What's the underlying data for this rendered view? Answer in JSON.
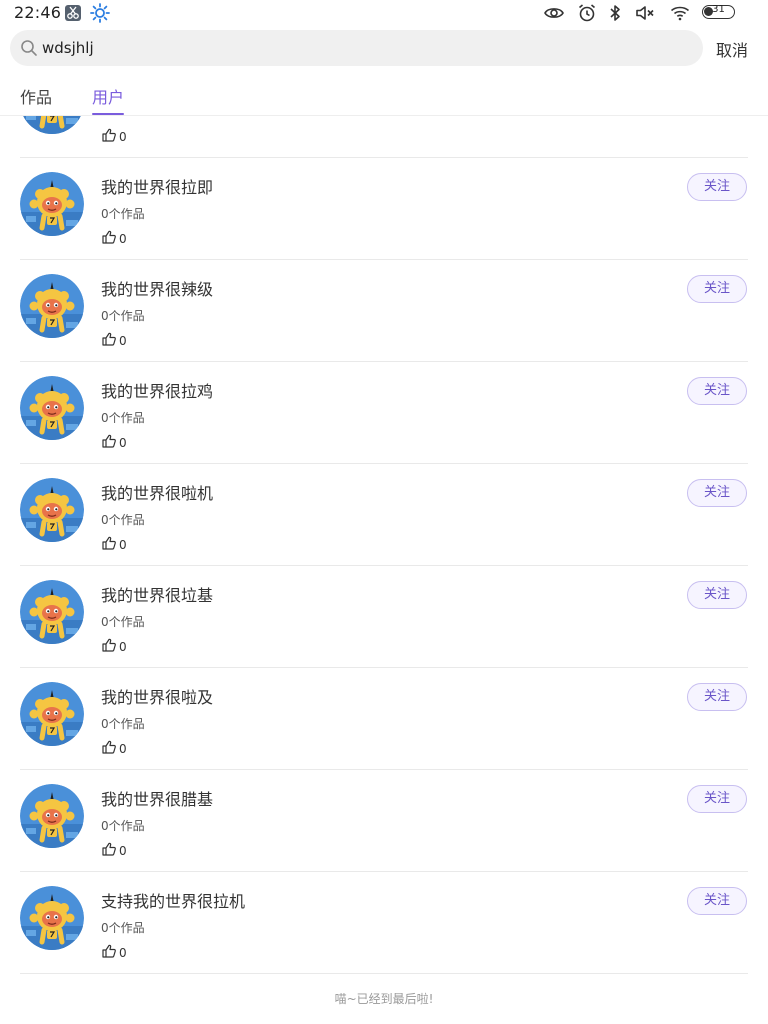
{
  "status_bar": {
    "time": "22:46",
    "battery_level": "31",
    "icons": [
      "scissors-app-icon",
      "brightness-icon",
      "eye-icon",
      "alarm-icon",
      "bluetooth-icon",
      "volume-muted-icon",
      "wifi-icon",
      "battery-icon"
    ]
  },
  "search": {
    "value": "wdsjhlj",
    "cancel_label": "取消"
  },
  "tabs": [
    {
      "label": "作品",
      "active": false
    },
    {
      "label": "用户",
      "active": true
    }
  ],
  "partial_user": {
    "like_count": "0"
  },
  "users": [
    {
      "name": "我的世界很拉即",
      "works": "0个作品",
      "likes": "0",
      "follow_label": "关注"
    },
    {
      "name": "我的世界很辣级",
      "works": "0个作品",
      "likes": "0",
      "follow_label": "关注"
    },
    {
      "name": "我的世界很拉鸡",
      "works": "0个作品",
      "likes": "0",
      "follow_label": "关注"
    },
    {
      "name": "我的世界很啦机",
      "works": "0个作品",
      "likes": "0",
      "follow_label": "关注"
    },
    {
      "name": "我的世界很垃基",
      "works": "0个作品",
      "likes": "0",
      "follow_label": "关注"
    },
    {
      "name": "我的世界很啦及",
      "works": "0个作品",
      "likes": "0",
      "follow_label": "关注"
    },
    {
      "name": "我的世界很腊基",
      "works": "0个作品",
      "likes": "0",
      "follow_label": "关注"
    },
    {
      "name": "支持我的世界很拉机",
      "works": "0个作品",
      "likes": "0",
      "follow_label": "关注"
    }
  ],
  "footer": "喵~已经到最后啦!",
  "colors": {
    "accent": "#7a5cdd",
    "follow_border": "#c8bff0",
    "follow_bg": "#f6f4ff",
    "avatar_bg": "#4a90d9",
    "avatar_character": "#f5c542"
  }
}
